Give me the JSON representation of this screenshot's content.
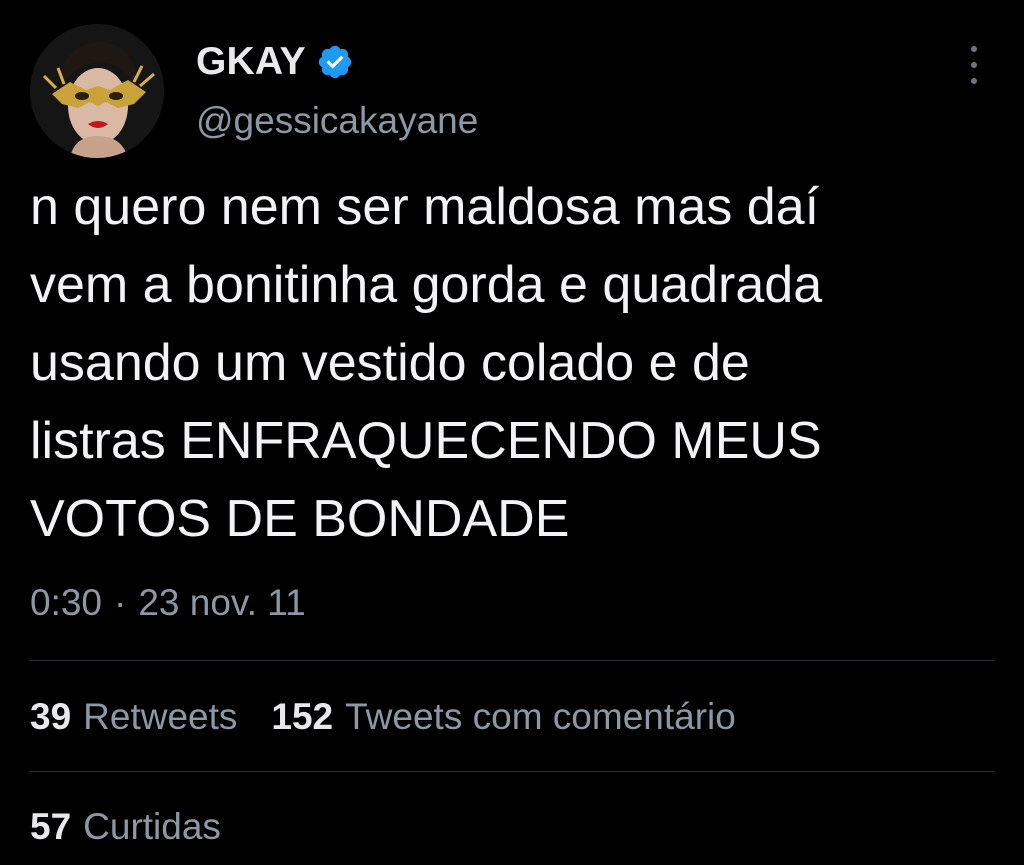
{
  "user": {
    "display_name": "GKAY",
    "handle": "@gessicakayane",
    "verified": true
  },
  "tweet": {
    "lines": [
      "n quero nem ser maldosa mas daí",
      "vem a bonitinha gorda e quadrada",
      "usando um vestido colado e de",
      "listras ENFRAQUECENDO MEUS",
      "VOTOS DE BONDADE"
    ],
    "time": "0:30",
    "separator": "·",
    "date": "23 nov. 11"
  },
  "stats": {
    "retweets_count": "39",
    "retweets_label": "Retweets",
    "quotes_count": "152",
    "quotes_label": "Tweets com comentário",
    "likes_count": "57",
    "likes_label": "Curtidas"
  },
  "icons": {
    "verified": "verified-badge-icon",
    "more": "more-options-icon"
  },
  "colors": {
    "background": "#000000",
    "primary_text": "#e7e9ea",
    "secondary_text": "#8b98a5",
    "verified_blue": "#1d9bf0",
    "divider": "#2f3336"
  }
}
